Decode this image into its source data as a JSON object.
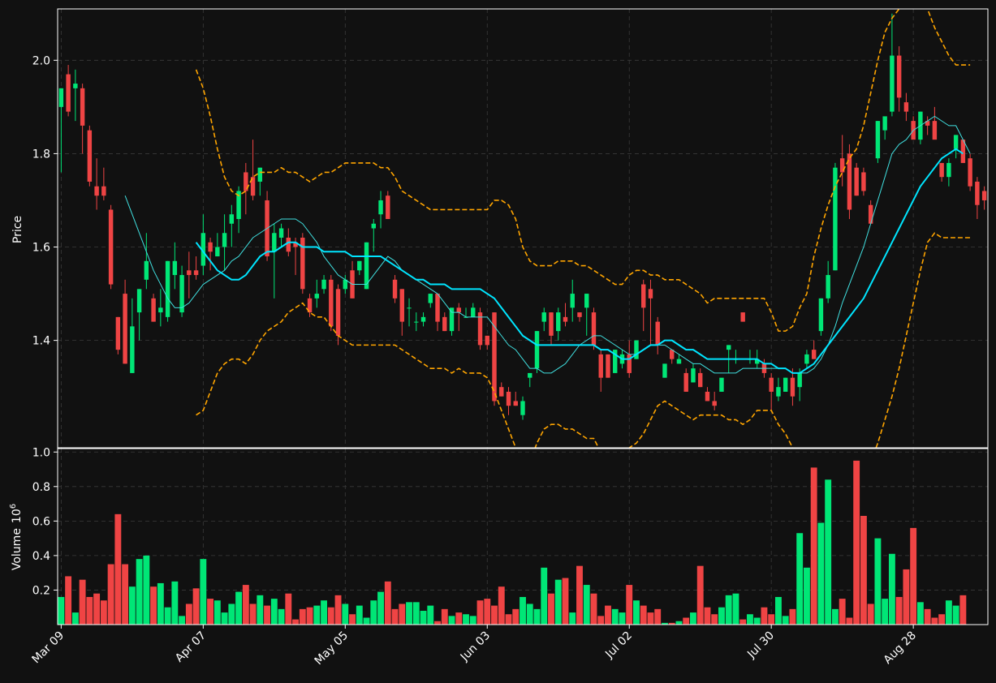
{
  "chart_data": [
    {
      "type": "candlestick",
      "ylabel": "Price",
      "ylim": [
        1.17,
        2.11
      ],
      "yticks": [
        1.4,
        1.6,
        1.8,
        2.0
      ],
      "grid": true,
      "series": [
        {
          "role": "ma_fast",
          "color": "#40e0e0"
        },
        {
          "role": "ma_slow",
          "color": "#00e5ff"
        },
        {
          "role": "bollinger_upper",
          "color": "#ffa500"
        },
        {
          "role": "bollinger_lower",
          "color": "#ffa500"
        }
      ]
    },
    {
      "type": "bar",
      "ylabel": "Volume",
      "yunit": "10",
      "yunit_exp": "6",
      "ylim": [
        0,
        1.02
      ],
      "yticks": [
        0.2,
        0.4,
        0.6,
        0.8,
        1.0
      ],
      "grid": true
    }
  ],
  "x_axis": {
    "tick_labels": [
      "Mar 09",
      "Apr 07",
      "May 05",
      "Jun 03",
      "Jul 02",
      "Jul 30",
      "Aug 28"
    ],
    "tick_index": [
      0,
      20,
      40,
      60,
      80,
      100,
      120
    ]
  },
  "colors": {
    "up": "#00e676",
    "down": "#ef4444",
    "background": "#111111",
    "grid": "#3a3a3a"
  },
  "ohlc": [
    [
      1.9,
      1.94,
      1.76,
      1.94
    ],
    [
      1.97,
      1.99,
      1.88,
      1.89
    ],
    [
      1.94,
      1.98,
      1.87,
      1.95
    ],
    [
      1.94,
      1.95,
      1.8,
      1.86
    ],
    [
      1.85,
      1.86,
      1.73,
      1.74
    ],
    [
      1.73,
      1.79,
      1.68,
      1.71
    ],
    [
      1.73,
      1.77,
      1.7,
      1.71
    ],
    [
      1.68,
      1.69,
      1.51,
      1.52
    ],
    [
      1.45,
      1.45,
      1.37,
      1.38
    ],
    [
      1.5,
      1.53,
      1.35,
      1.35
    ],
    [
      1.33,
      1.49,
      1.33,
      1.43
    ],
    [
      1.46,
      1.51,
      1.4,
      1.51
    ],
    [
      1.53,
      1.63,
      1.51,
      1.57
    ],
    [
      1.49,
      1.5,
      1.44,
      1.44
    ],
    [
      1.46,
      1.51,
      1.43,
      1.47
    ],
    [
      1.45,
      1.57,
      1.44,
      1.57
    ],
    [
      1.54,
      1.61,
      1.51,
      1.57
    ],
    [
      1.46,
      1.56,
      1.45,
      1.54
    ],
    [
      1.55,
      1.59,
      1.49,
      1.54
    ],
    [
      1.55,
      1.58,
      1.53,
      1.54
    ],
    [
      1.56,
      1.67,
      1.54,
      1.63
    ],
    [
      1.61,
      1.62,
      1.55,
      1.59
    ],
    [
      1.58,
      1.63,
      1.58,
      1.6
    ],
    [
      1.6,
      1.67,
      1.55,
      1.63
    ],
    [
      1.65,
      1.69,
      1.6,
      1.67
    ],
    [
      1.66,
      1.73,
      1.63,
      1.72
    ],
    [
      1.76,
      1.78,
      1.67,
      1.72
    ],
    [
      1.75,
      1.83,
      1.7,
      1.71
    ],
    [
      1.74,
      1.77,
      1.71,
      1.77
    ],
    [
      1.7,
      1.72,
      1.57,
      1.58
    ],
    [
      1.59,
      1.65,
      1.49,
      1.63
    ],
    [
      1.62,
      1.65,
      1.6,
      1.64
    ],
    [
      1.62,
      1.64,
      1.58,
      1.59
    ],
    [
      1.61,
      1.62,
      1.54,
      1.6
    ],
    [
      1.62,
      1.63,
      1.5,
      1.51
    ],
    [
      1.49,
      1.5,
      1.45,
      1.46
    ],
    [
      1.49,
      1.53,
      1.47,
      1.5
    ],
    [
      1.51,
      1.54,
      1.5,
      1.53
    ],
    [
      1.53,
      1.54,
      1.42,
      1.43
    ],
    [
      1.51,
      1.52,
      1.39,
      1.41
    ],
    [
      1.51,
      1.54,
      1.5,
      1.53
    ],
    [
      1.55,
      1.57,
      1.49,
      1.49
    ],
    [
      1.55,
      1.57,
      1.54,
      1.57
    ],
    [
      1.51,
      1.61,
      1.51,
      1.61
    ],
    [
      1.64,
      1.66,
      1.59,
      1.65
    ],
    [
      1.67,
      1.72,
      1.64,
      1.7
    ],
    [
      1.71,
      1.72,
      1.66,
      1.66
    ],
    [
      1.53,
      1.54,
      1.48,
      1.49
    ],
    [
      1.51,
      1.51,
      1.41,
      1.44
    ],
    [
      1.47,
      1.49,
      1.43,
      1.47
    ],
    [
      1.44,
      1.46,
      1.42,
      1.44
    ],
    [
      1.44,
      1.46,
      1.43,
      1.45
    ],
    [
      1.48,
      1.5,
      1.47,
      1.5
    ],
    [
      1.5,
      1.5,
      1.42,
      1.44
    ],
    [
      1.45,
      1.46,
      1.42,
      1.42
    ],
    [
      1.42,
      1.45,
      1.41,
      1.47
    ],
    [
      1.47,
      1.48,
      1.42,
      1.46
    ],
    [
      1.45,
      1.47,
      1.45,
      1.45
    ],
    [
      1.45,
      1.48,
      1.45,
      1.47
    ],
    [
      1.46,
      1.47,
      1.38,
      1.39
    ],
    [
      1.41,
      1.41,
      1.38,
      1.39
    ],
    [
      1.46,
      1.46,
      1.26,
      1.27
    ],
    [
      1.3,
      1.31,
      1.28,
      1.28
    ],
    [
      1.29,
      1.3,
      1.24,
      1.26
    ],
    [
      1.27,
      1.29,
      1.26,
      1.26
    ],
    [
      1.24,
      1.28,
      1.23,
      1.27
    ],
    [
      1.32,
      1.33,
      1.3,
      1.33
    ],
    [
      1.34,
      1.42,
      1.33,
      1.42
    ],
    [
      1.44,
      1.47,
      1.42,
      1.46
    ],
    [
      1.46,
      1.46,
      1.39,
      1.41
    ],
    [
      1.42,
      1.47,
      1.4,
      1.46
    ],
    [
      1.45,
      1.48,
      1.43,
      1.44
    ],
    [
      1.47,
      1.53,
      1.44,
      1.5
    ],
    [
      1.46,
      1.46,
      1.44,
      1.45
    ],
    [
      1.47,
      1.5,
      1.41,
      1.5
    ],
    [
      1.46,
      1.47,
      1.38,
      1.39
    ],
    [
      1.37,
      1.38,
      1.29,
      1.32
    ],
    [
      1.37,
      1.37,
      1.32,
      1.32
    ],
    [
      1.33,
      1.38,
      1.33,
      1.38
    ],
    [
      1.35,
      1.38,
      1.34,
      1.37
    ],
    [
      1.37,
      1.4,
      1.32,
      1.33
    ],
    [
      1.36,
      1.4,
      1.36,
      1.4
    ],
    [
      1.52,
      1.53,
      1.42,
      1.47
    ],
    [
      1.51,
      1.53,
      1.39,
      1.49
    ],
    [
      1.44,
      1.45,
      1.37,
      1.39
    ],
    [
      1.32,
      1.35,
      1.32,
      1.35
    ],
    [
      1.38,
      1.38,
      1.35,
      1.36
    ],
    [
      1.35,
      1.37,
      1.35,
      1.36
    ],
    [
      1.33,
      1.34,
      1.29,
      1.29
    ],
    [
      1.31,
      1.35,
      1.31,
      1.34
    ],
    [
      1.33,
      1.34,
      1.3,
      1.3
    ],
    [
      1.29,
      1.3,
      1.27,
      1.27
    ],
    [
      1.27,
      1.29,
      1.25,
      1.26
    ],
    [
      1.29,
      1.3,
      1.29,
      1.32
    ],
    [
      1.38,
      1.39,
      1.33,
      1.39
    ],
    [
      1.36,
      1.38,
      1.35,
      1.36
    ],
    [
      1.46,
      1.46,
      1.44,
      1.44
    ],
    [
      1.36,
      1.38,
      1.35,
      1.36
    ],
    [
      1.35,
      1.38,
      1.34,
      1.36
    ],
    [
      1.35,
      1.36,
      1.32,
      1.33
    ],
    [
      1.32,
      1.33,
      1.25,
      1.29
    ],
    [
      1.28,
      1.32,
      1.27,
      1.3
    ],
    [
      1.29,
      1.32,
      1.29,
      1.32
    ],
    [
      1.32,
      1.34,
      1.26,
      1.28
    ],
    [
      1.3,
      1.34,
      1.27,
      1.33
    ],
    [
      1.35,
      1.38,
      1.34,
      1.37
    ],
    [
      1.38,
      1.4,
      1.36,
      1.36
    ],
    [
      1.42,
      1.49,
      1.41,
      1.49
    ],
    [
      1.49,
      1.57,
      1.48,
      1.54
    ],
    [
      1.55,
      1.78,
      1.55,
      1.77
    ],
    [
      1.79,
      1.84,
      1.73,
      1.76
    ],
    [
      1.8,
      1.82,
      1.66,
      1.68
    ],
    [
      1.77,
      1.78,
      1.71,
      1.71
    ],
    [
      1.76,
      1.77,
      1.71,
      1.72
    ],
    [
      1.69,
      1.7,
      1.65,
      1.65
    ],
    [
      1.79,
      1.87,
      1.78,
      1.87
    ],
    [
      1.85,
      1.87,
      1.83,
      1.88
    ],
    [
      1.89,
      2.1,
      1.88,
      2.01
    ],
    [
      2.01,
      2.03,
      1.89,
      1.92
    ],
    [
      1.91,
      1.93,
      1.87,
      1.89
    ],
    [
      1.87,
      1.88,
      1.84,
      1.83
    ],
    [
      1.83,
      1.89,
      1.82,
      1.89
    ],
    [
      1.87,
      1.88,
      1.84,
      1.86
    ],
    [
      1.87,
      1.9,
      1.84,
      1.83
    ],
    [
      1.78,
      1.78,
      1.74,
      1.75
    ],
    [
      1.75,
      1.79,
      1.73,
      1.78
    ],
    [
      1.81,
      1.84,
      1.79,
      1.84
    ],
    [
      1.83,
      1.83,
      1.78,
      1.78
    ],
    [
      1.79,
      1.8,
      1.72,
      1.73
    ],
    [
      1.74,
      1.75,
      1.66,
      1.69
    ],
    [
      1.72,
      1.73,
      1.68,
      1.7
    ]
  ],
  "volume": [
    0.16,
    0.28,
    0.07,
    0.26,
    0.16,
    0.18,
    0.14,
    0.35,
    0.64,
    0.35,
    0.22,
    0.38,
    0.4,
    0.22,
    0.24,
    0.1,
    0.25,
    0.05,
    0.12,
    0.21,
    0.38,
    0.15,
    0.14,
    0.07,
    0.12,
    0.19,
    0.23,
    0.12,
    0.17,
    0.11,
    0.15,
    0.09,
    0.18,
    0.03,
    0.09,
    0.1,
    0.11,
    0.14,
    0.1,
    0.17,
    0.12,
    0.06,
    0.11,
    0.04,
    0.14,
    0.19,
    0.25,
    0.09,
    0.12,
    0.13,
    0.13,
    0.08,
    0.11,
    0.02,
    0.09,
    0.05,
    0.07,
    0.06,
    0.05,
    0.14,
    0.15,
    0.11,
    0.22,
    0.06,
    0.09,
    0.16,
    0.12,
    0.09,
    0.33,
    0.18,
    0.26,
    0.27,
    0.07,
    0.34,
    0.23,
    0.18,
    0.05,
    0.11,
    0.09,
    0.07,
    0.23,
    0.14,
    0.11,
    0.07,
    0.09,
    0.01,
    0.01,
    0.02,
    0.04,
    0.07,
    0.34,
    0.1,
    0.06,
    0.1,
    0.17,
    0.18,
    0.03,
    0.06,
    0.04,
    0.1,
    0.06,
    0.16,
    0.05,
    0.09,
    0.53,
    0.33,
    0.91,
    0.59,
    0.84,
    0.09,
    0.15,
    0.04,
    0.95,
    0.63,
    0.12,
    0.5,
    0.15,
    0.41,
    0.16,
    0.32,
    0.56,
    0.13,
    0.09,
    0.04,
    0.06,
    0.14,
    0.11,
    0.17
  ],
  "ma_fast": [
    null,
    null,
    null,
    null,
    null,
    null,
    null,
    null,
    null,
    1.71,
    1.67,
    1.63,
    1.59,
    1.55,
    1.52,
    1.49,
    1.47,
    1.47,
    1.48,
    1.5,
    1.52,
    1.53,
    1.54,
    1.55,
    1.57,
    1.58,
    1.6,
    1.62,
    1.63,
    1.64,
    1.65,
    1.66,
    1.66,
    1.66,
    1.65,
    1.63,
    1.61,
    1.58,
    1.56,
    1.54,
    1.53,
    1.52,
    1.52,
    1.52,
    1.54,
    1.56,
    1.58,
    1.57,
    1.55,
    1.54,
    1.53,
    1.52,
    1.51,
    1.5,
    1.48,
    1.46,
    1.46,
    1.45,
    1.45,
    1.45,
    1.45,
    1.43,
    1.41,
    1.39,
    1.38,
    1.36,
    1.34,
    1.34,
    1.33,
    1.33,
    1.34,
    1.35,
    1.37,
    1.39,
    1.4,
    1.41,
    1.41,
    1.4,
    1.39,
    1.38,
    1.37,
    1.37,
    1.38,
    1.39,
    1.39,
    1.39,
    1.38,
    1.37,
    1.36,
    1.35,
    1.35,
    1.34,
    1.33,
    1.33,
    1.33,
    1.33,
    1.34,
    1.34,
    1.34,
    1.34,
    1.34,
    1.34,
    1.34,
    1.33,
    1.33,
    1.33,
    1.34,
    1.36,
    1.39,
    1.43,
    1.48,
    1.52,
    1.56,
    1.6,
    1.65,
    1.7,
    1.75,
    1.8,
    1.82,
    1.83,
    1.85,
    1.86,
    1.87,
    1.88,
    1.87,
    1.86,
    1.86,
    1.83,
    1.8
  ],
  "ma_slow": [
    null,
    null,
    null,
    null,
    null,
    null,
    null,
    null,
    null,
    null,
    null,
    null,
    null,
    null,
    null,
    null,
    null,
    null,
    null,
    1.61,
    1.59,
    1.57,
    1.55,
    1.54,
    1.53,
    1.53,
    1.54,
    1.56,
    1.58,
    1.59,
    1.59,
    1.6,
    1.61,
    1.61,
    1.6,
    1.6,
    1.6,
    1.59,
    1.59,
    1.59,
    1.59,
    1.58,
    1.58,
    1.58,
    1.58,
    1.58,
    1.57,
    1.56,
    1.55,
    1.54,
    1.53,
    1.53,
    1.52,
    1.52,
    1.52,
    1.51,
    1.51,
    1.51,
    1.51,
    1.51,
    1.5,
    1.49,
    1.47,
    1.45,
    1.43,
    1.41,
    1.4,
    1.39,
    1.39,
    1.39,
    1.39,
    1.39,
    1.39,
    1.39,
    1.39,
    1.39,
    1.38,
    1.38,
    1.37,
    1.36,
    1.36,
    1.37,
    1.38,
    1.39,
    1.39,
    1.4,
    1.4,
    1.39,
    1.38,
    1.38,
    1.37,
    1.36,
    1.36,
    1.36,
    1.36,
    1.36,
    1.36,
    1.36,
    1.36,
    1.35,
    1.35,
    1.34,
    1.34,
    1.33,
    1.33,
    1.34,
    1.35,
    1.37,
    1.39,
    1.41,
    1.43,
    1.45,
    1.47,
    1.49,
    1.52,
    1.55,
    1.58,
    1.61,
    1.64,
    1.67,
    1.7,
    1.73,
    1.75,
    1.77,
    1.79,
    1.8,
    1.81,
    1.8
  ],
  "bb_upper": [
    null,
    null,
    null,
    null,
    null,
    null,
    null,
    null,
    null,
    null,
    null,
    null,
    null,
    null,
    null,
    null,
    null,
    null,
    null,
    1.98,
    1.94,
    1.88,
    1.81,
    1.75,
    1.72,
    1.71,
    1.72,
    1.75,
    1.76,
    1.76,
    1.76,
    1.77,
    1.76,
    1.76,
    1.75,
    1.74,
    1.75,
    1.76,
    1.76,
    1.77,
    1.78,
    1.78,
    1.78,
    1.78,
    1.78,
    1.77,
    1.77,
    1.75,
    1.72,
    1.71,
    1.7,
    1.69,
    1.68,
    1.68,
    1.68,
    1.68,
    1.68,
    1.68,
    1.68,
    1.68,
    1.68,
    1.7,
    1.7,
    1.69,
    1.66,
    1.6,
    1.57,
    1.56,
    1.56,
    1.56,
    1.57,
    1.57,
    1.57,
    1.56,
    1.56,
    1.55,
    1.54,
    1.53,
    1.52,
    1.52,
    1.54,
    1.55,
    1.55,
    1.54,
    1.54,
    1.53,
    1.53,
    1.53,
    1.52,
    1.51,
    1.5,
    1.48,
    1.49,
    1.49,
    1.49,
    1.49,
    1.49,
    1.49,
    1.49,
    1.49,
    1.46,
    1.42,
    1.42,
    1.43,
    1.47,
    1.5,
    1.58,
    1.64,
    1.69,
    1.73,
    1.76,
    1.79,
    1.81,
    1.86,
    1.93,
    2.0,
    2.06,
    2.09,
    2.11,
    2.12,
    2.13,
    2.13,
    2.11,
    2.07,
    2.04,
    2.01,
    1.99,
    1.99,
    1.99
  ],
  "bb_lower": [
    null,
    null,
    null,
    null,
    null,
    null,
    null,
    null,
    null,
    null,
    null,
    null,
    null,
    null,
    null,
    null,
    null,
    null,
    null,
    1.24,
    1.25,
    1.29,
    1.33,
    1.35,
    1.36,
    1.36,
    1.35,
    1.37,
    1.4,
    1.42,
    1.43,
    1.44,
    1.46,
    1.47,
    1.48,
    1.46,
    1.45,
    1.45,
    1.43,
    1.41,
    1.4,
    1.39,
    1.39,
    1.39,
    1.39,
    1.39,
    1.39,
    1.39,
    1.38,
    1.37,
    1.36,
    1.35,
    1.34,
    1.34,
    1.34,
    1.33,
    1.34,
    1.33,
    1.33,
    1.33,
    1.32,
    1.29,
    1.25,
    1.21,
    1.17,
    1.14,
    1.14,
    1.18,
    1.21,
    1.22,
    1.22,
    1.21,
    1.21,
    1.2,
    1.19,
    1.19,
    1.16,
    1.13,
    1.13,
    1.14,
    1.17,
    1.18,
    1.2,
    1.23,
    1.26,
    1.27,
    1.26,
    1.25,
    1.24,
    1.23,
    1.24,
    1.24,
    1.24,
    1.24,
    1.23,
    1.23,
    1.22,
    1.23,
    1.25,
    1.25,
    1.25,
    1.22,
    1.2,
    1.17,
    1.14,
    1.11,
    1.09,
    1.07,
    1.05,
    1.03,
    1.03,
    1.04,
    1.07,
    1.1,
    1.14,
    1.18,
    1.23,
    1.28,
    1.34,
    1.41,
    1.48,
    1.55,
    1.61,
    1.63,
    1.62,
    1.62,
    1.62,
    1.62,
    1.62
  ]
}
